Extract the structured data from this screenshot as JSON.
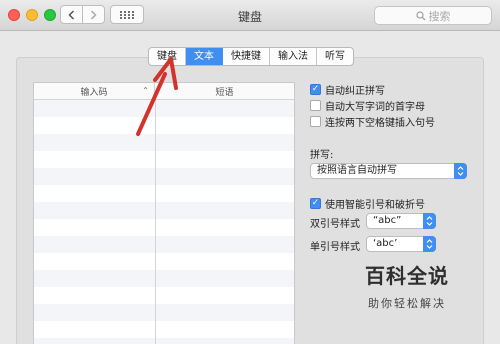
{
  "window": {
    "title": "键盘",
    "search_placeholder": "搜索"
  },
  "tabs": [
    {
      "label": "键盘",
      "active": false
    },
    {
      "label": "文本",
      "active": true
    },
    {
      "label": "快捷键",
      "active": false
    },
    {
      "label": "输入法",
      "active": false
    },
    {
      "label": "听写",
      "active": false
    }
  ],
  "table": {
    "col_input": "输入码",
    "col_phrase": "短语"
  },
  "options": {
    "auto_correct": {
      "label": "自动纠正拼写",
      "checked": true
    },
    "auto_capitalize": {
      "label": "自动大写字词的首字母",
      "checked": false
    },
    "double_space_period": {
      "label": "连按两下空格键插入句号",
      "checked": false
    },
    "spelling_label": "拼写:",
    "spelling_value": "按照语言自动拼写",
    "smart_quotes": {
      "label": "使用智能引号和破折号",
      "checked": true
    },
    "double_quote_label": "双引号样式",
    "double_quote_value": "“abc”",
    "single_quote_label": "单引号样式",
    "single_quote_value": "‘abc’"
  },
  "watermark": {
    "title": "百科全说",
    "subtitle": "助你轻松解决"
  },
  "colors": {
    "accent": "#3f8ef0",
    "annotation_arrow": "#d0342c"
  }
}
